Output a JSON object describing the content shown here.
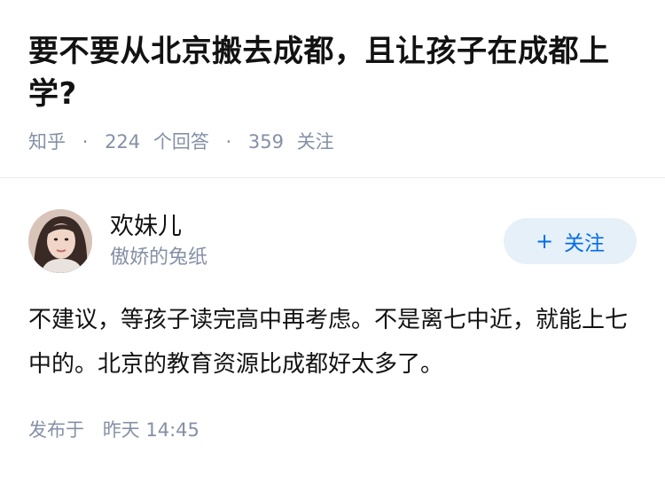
{
  "question": {
    "title": "要不要从北京搬去成都，且让孩子在成都上学?",
    "source": "知乎",
    "separator": "·",
    "answer_count": "224",
    "answer_label": "个回答",
    "follower_count": "359",
    "follower_label": "关注"
  },
  "author": {
    "name": "欢妹儿",
    "bio": "傲娇的兔纸",
    "avatar_icon": "user-avatar-photo",
    "follow_label": "关注",
    "follow_icon": "plus-icon"
  },
  "answer": {
    "text": "不建议，等孩子读完高中再考虑。不是离七中近，就能上七中的。北京的教育资源比成都好太多了。",
    "published_label": "发布于",
    "published_time": "昨天 14:45"
  },
  "colors": {
    "text": "#121212",
    "meta": "#8590a6",
    "accent": "#056de8",
    "button_bg": "#e6f0f9"
  }
}
